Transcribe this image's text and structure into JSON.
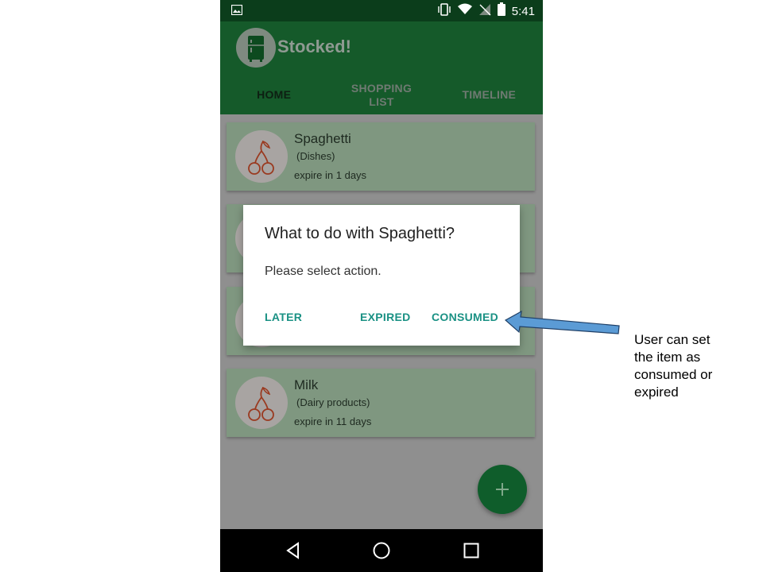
{
  "status_bar": {
    "time": "5:41",
    "left_icon": "image-icon",
    "right_icons": [
      "vibrate-icon",
      "wifi-icon",
      "no-signal-icon",
      "battery-icon"
    ]
  },
  "app_bar": {
    "title": "Stocked!",
    "logo_icon": "fridge-icon",
    "tabs": [
      {
        "line1": "HOME",
        "line2": "",
        "active": true
      },
      {
        "line1": "SHOPPING",
        "line2": "LIST",
        "active": false
      },
      {
        "line1": "TIMELINE",
        "line2": "",
        "active": false
      }
    ]
  },
  "items": [
    {
      "name": "Spaghetti",
      "category": "(Dishes)",
      "expiry": "expire in 1 days",
      "icon": "cherry-icon"
    },
    {
      "name": "",
      "category": "",
      "expiry": "",
      "icon": "cherry-icon"
    },
    {
      "name": "",
      "category": "",
      "expiry": "",
      "icon": "cherry-icon"
    },
    {
      "name": "Milk",
      "category": "(Dairy products)",
      "expiry": "expire in 11 days",
      "icon": "cherry-icon"
    }
  ],
  "fab": {
    "icon": "plus-icon"
  },
  "dialog": {
    "title": "What to do with Spaghetti?",
    "message": "Please select action.",
    "buttons": {
      "later": "LATER",
      "expired": "EXPIRED",
      "consumed": "CONSUMED"
    }
  },
  "navigation": {
    "icons": [
      "back-icon",
      "home-icon",
      "recents-icon"
    ]
  },
  "annotation": {
    "lines": [
      "User can set",
      "the item as",
      "consumed or",
      "expired"
    ]
  },
  "colors": {
    "app_bar": "#155a2a",
    "status_bar": "#0b3d1b",
    "accent": "#1a9184",
    "fab": "#0f5d2b",
    "arrow": "#5b9bd5"
  }
}
